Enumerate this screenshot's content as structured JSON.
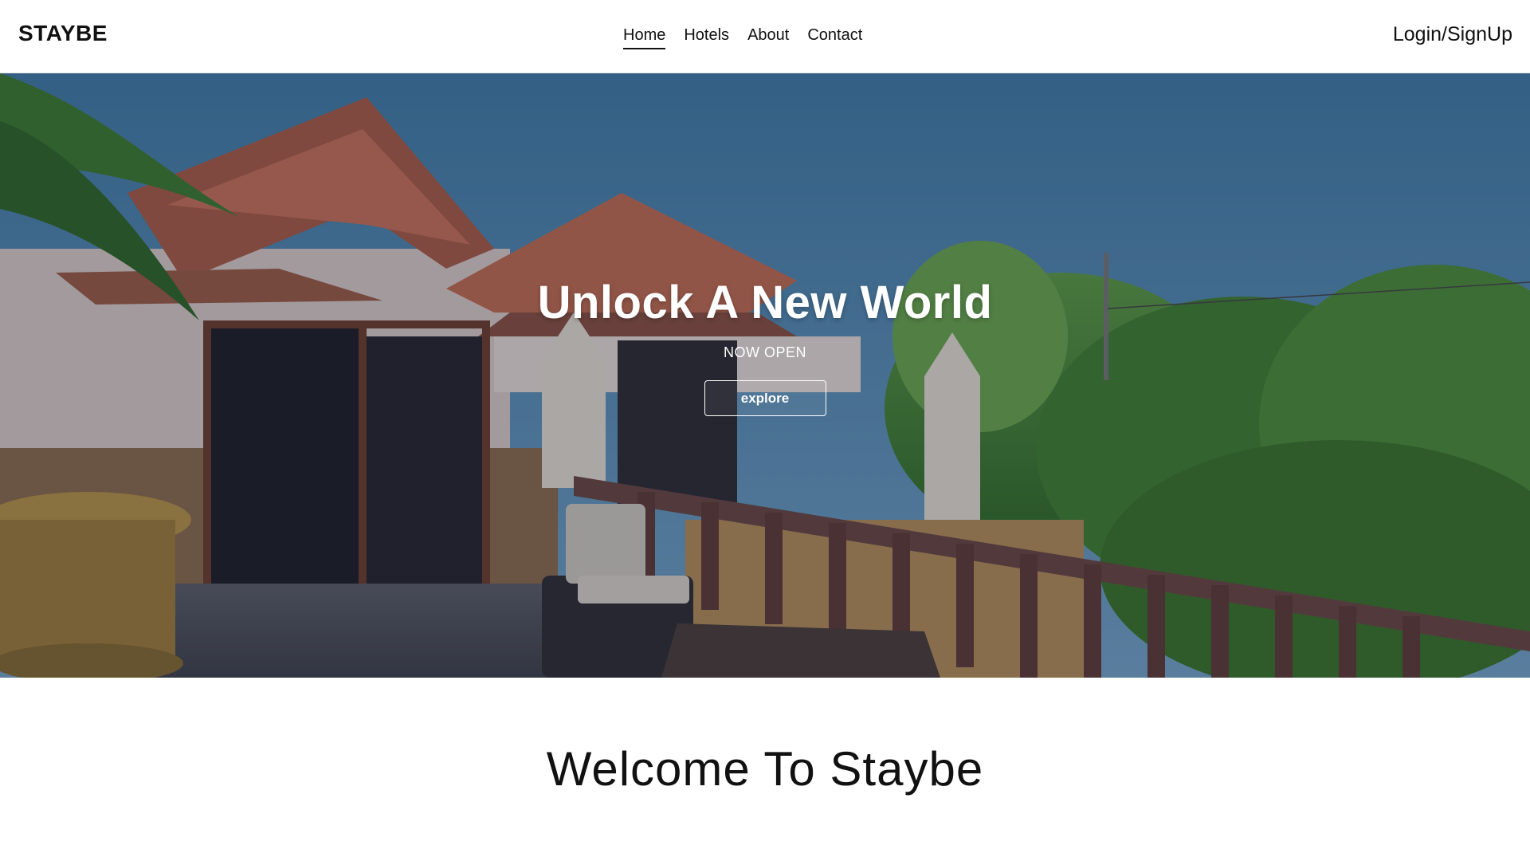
{
  "header": {
    "brand": "STAYBE",
    "nav": [
      {
        "label": "Home",
        "active": true
      },
      {
        "label": "Hotels",
        "active": false
      },
      {
        "label": "About",
        "active": false
      },
      {
        "label": "Contact",
        "active": false
      }
    ],
    "login_label": "Login/SignUp"
  },
  "hero": {
    "title": "Unlock A New World",
    "subtitle": "NOW OPEN",
    "button_label": "explore",
    "image": "resort-villa-photo"
  },
  "welcome": {
    "heading": "Welcome To Staybe"
  },
  "colors": {
    "text": "#111111",
    "hero_text": "#ffffff",
    "sky": "#4a7ca4",
    "roof": "#b9664a",
    "foliage": "#4e8b38"
  }
}
